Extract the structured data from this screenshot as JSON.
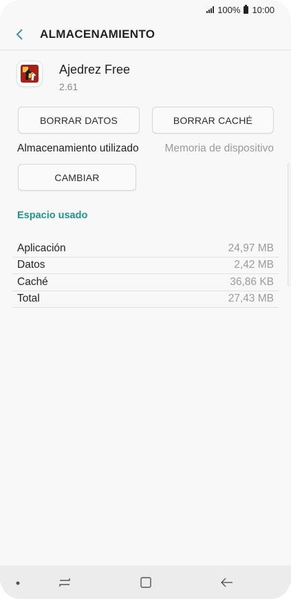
{
  "status_bar": {
    "battery": "100%",
    "time": "10:00"
  },
  "header": {
    "title": "ALMACENAMIENTO"
  },
  "app": {
    "name": "Ajedrez Free",
    "version": "2.61"
  },
  "buttons": {
    "clear_data": "BORRAR DATOS",
    "clear_cache": "BORRAR CACHÉ",
    "change": "CAMBIAR"
  },
  "storage": {
    "label": "Almacenamiento utilizado",
    "value": "Memoria de dispositivo"
  },
  "usage": {
    "title": "Espacio usado",
    "rows": [
      {
        "label": "Aplicación",
        "value": "24,97 MB"
      },
      {
        "label": "Datos",
        "value": "2,42 MB"
      },
      {
        "label": "Caché",
        "value": "36,86 KB"
      },
      {
        "label": "Total",
        "value": "27,43 MB"
      }
    ]
  },
  "icons": {
    "back": "back-arrow-icon",
    "app": "chess-app-icon",
    "signal": "signal-icon",
    "battery": "battery-icon",
    "nav": [
      "dot-icon",
      "recents-icon",
      "home-icon",
      "back-icon"
    ]
  },
  "colors": {
    "accent": "#21958d",
    "background": "#f8f8f8",
    "nav_bar": "#ececec"
  }
}
